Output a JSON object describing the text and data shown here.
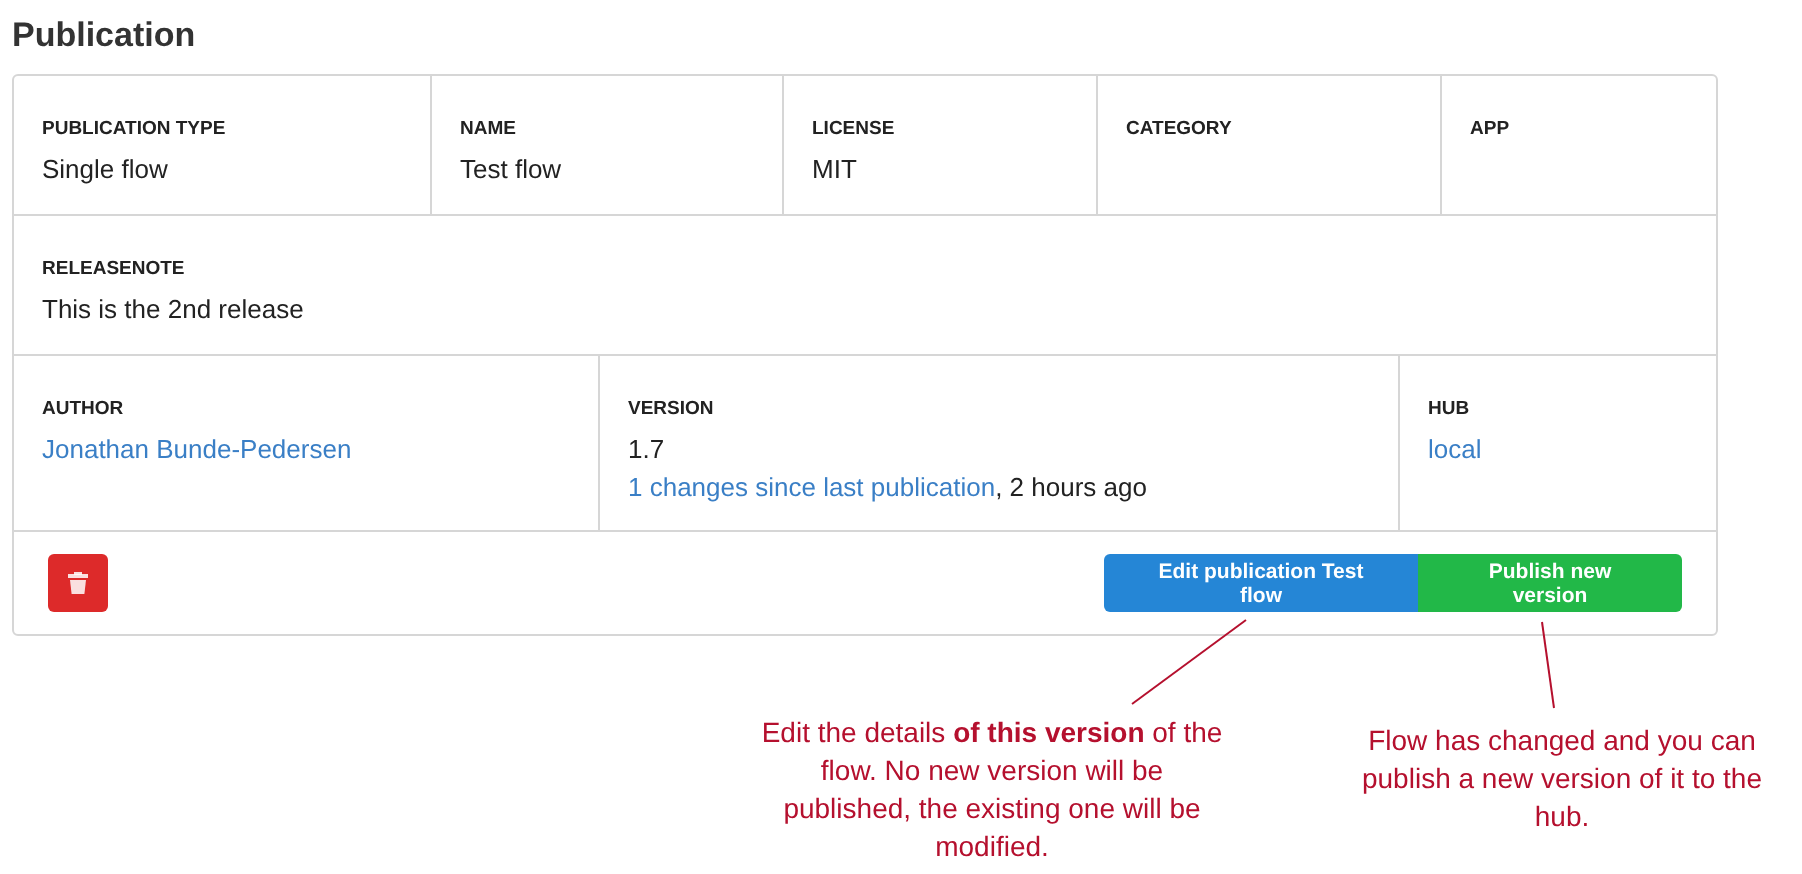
{
  "title": "Publication",
  "rows": [
    {
      "cells": [
        {
          "label": "PUBLICATION TYPE",
          "value": "Single flow",
          "kind": "text"
        },
        {
          "label": "NAME",
          "value": "Test flow",
          "kind": "text"
        },
        {
          "label": "LICENSE",
          "value": "MIT",
          "kind": "text"
        },
        {
          "label": "CATEGORY",
          "kind": "empty"
        },
        {
          "label": "APP",
          "kind": "empty"
        }
      ]
    },
    {
      "cells": [
        {
          "label": "RELEASENOTE",
          "value": "This is the 2nd release",
          "kind": "text"
        }
      ]
    },
    {
      "cells": [
        {
          "label": "AUTHOR",
          "value": "Jonathan Bunde-Pedersen",
          "kind": "link"
        },
        {
          "label": "VERSION",
          "value": "1.7",
          "kind": "version",
          "changes_link": "1 changes since last publication",
          "changes_suffix": ", 2 hours ago"
        },
        {
          "label": "HUB",
          "value": "local",
          "kind": "link"
        }
      ]
    }
  ],
  "buttons": [
    {
      "label": "Edit publication Test flow",
      "kind": "edit"
    },
    {
      "label": "Publish new version",
      "kind": "publish"
    }
  ],
  "annotations": [
    "Edit the details **of this version** of the flow. No new version will be published, the existing one will be modified.",
    "Flow has changed and you can publish a new version of it to the hub."
  ]
}
